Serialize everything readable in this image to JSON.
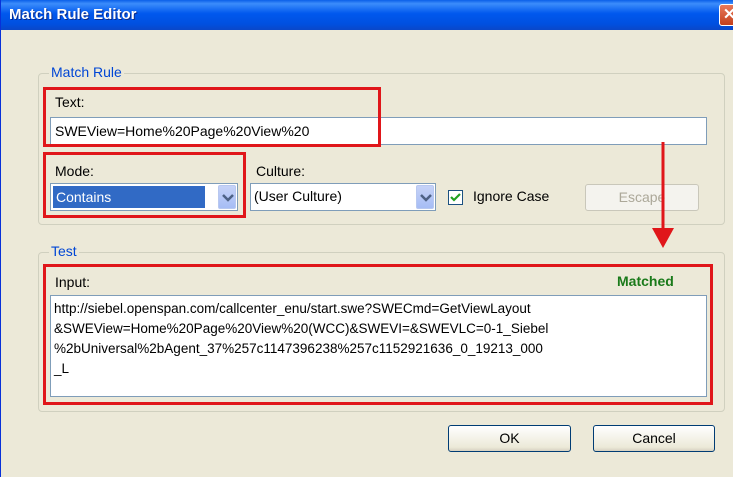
{
  "window": {
    "title": "Match Rule Editor",
    "close_glyph": "✕"
  },
  "match_rule": {
    "group_label": "Match Rule",
    "text_label": "Text:",
    "text_value": "SWEView=Home%20Page%20View%20",
    "mode_label": "Mode:",
    "mode_value": "Contains",
    "culture_label": "Culture:",
    "culture_value": "(User Culture)",
    "ignore_case_label": "Ignore Case",
    "ignore_case_checked": true,
    "escape_label": "Escape"
  },
  "test": {
    "group_label": "Test",
    "input_label": "Input:",
    "status": "Matched",
    "status_color": "#1a7a1a",
    "input_lines": [
      "http://siebel.openspan.com/callcenter_enu/start.swe?SWECmd=GetViewLayout",
      "&SWEView=Home%20Page%20View%20(WCC)&SWEVI=&SWEVLC=0-1_Siebel",
      "%2bUniversal%2bAgent_37%257c1147396238%257c1152921636_0_19213_000",
      "_L"
    ]
  },
  "buttons": {
    "ok": "OK",
    "cancel": "Cancel"
  },
  "colors": {
    "highlight": "#e0161a",
    "title_bar": "#0058ee",
    "selection": "#316ac5"
  }
}
